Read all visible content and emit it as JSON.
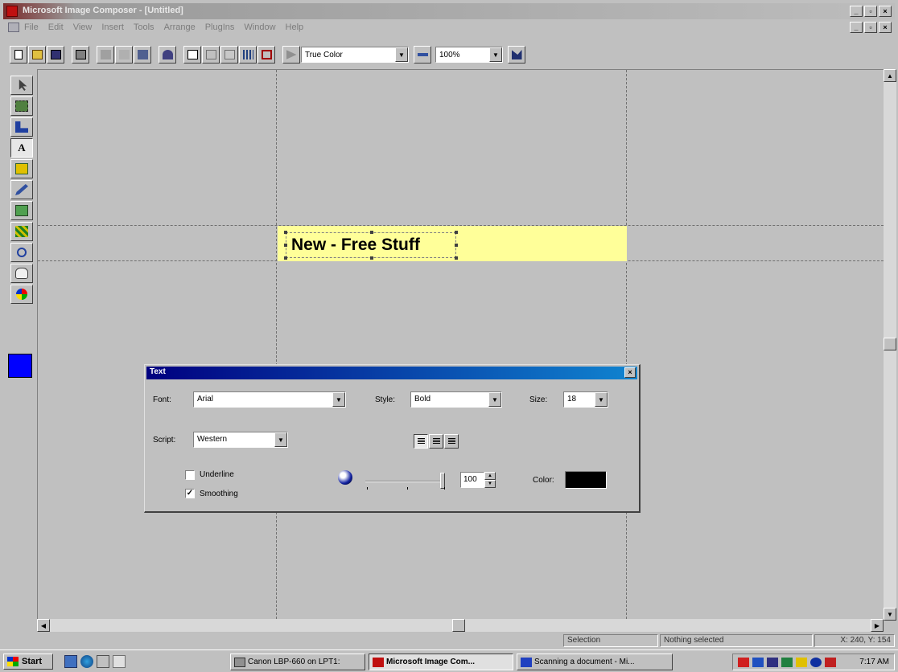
{
  "window": {
    "title": "Microsoft Image Composer - [Untitled]",
    "min": "_",
    "max": "▫",
    "close": "×"
  },
  "menu": {
    "items": [
      "File",
      "Edit",
      "View",
      "Insert",
      "Tools",
      "Arrange",
      "PlugIns",
      "Window",
      "Help"
    ]
  },
  "toolbar": {
    "color_format": "True Color",
    "zoom": "100%",
    "buttons": [
      "new-icon",
      "open-icon",
      "save-icon",
      "print-icon",
      "cut-icon",
      "copy-icon",
      "paste-icon",
      "undo-icon",
      "insert-icon",
      "delete-icon",
      "duplicate-icon",
      "arrange-icon",
      "select-all-icon",
      "play-icon",
      "frame-icon",
      "help-icon"
    ]
  },
  "palette": {
    "tools": [
      "arrow-icon",
      "cutout-icon",
      "crop-icon",
      "text-tool-icon",
      "shapes-icon",
      "paint-icon",
      "effects-icon",
      "texture-icon",
      "zoom-icon",
      "pan-icon",
      "color-tuning-icon"
    ],
    "text_tool_glyph": "A",
    "current_color": "#0000ff"
  },
  "canvas": {
    "text": "New - Free Stuff",
    "banner_color": "#ffff99"
  },
  "status": {
    "mode": "Selection",
    "selection": "Nothing selected",
    "coords": "X: 240, Y: 154"
  },
  "taskbar": {
    "start": "Start",
    "tasks": [
      "Canon LBP-660 on LPT1:",
      "Microsoft Image Com...",
      "Scanning a document - Mi..."
    ],
    "clock": "7:17 AM"
  },
  "text_dialog": {
    "title": "Text",
    "font_label": "Font:",
    "font_value": "Arial",
    "style_label": "Style:",
    "style_value": "Bold",
    "size_label": "Size:",
    "size_value": "18",
    "script_label": "Script:",
    "script_value": "Western",
    "underline_label": "Underline",
    "underline_checked": false,
    "smoothing_label": "Smoothing",
    "smoothing_checked": "✓",
    "opacity_value": "100",
    "opacity_fraction": 1.0,
    "color_label": "Color:",
    "color_value": "#000000"
  }
}
